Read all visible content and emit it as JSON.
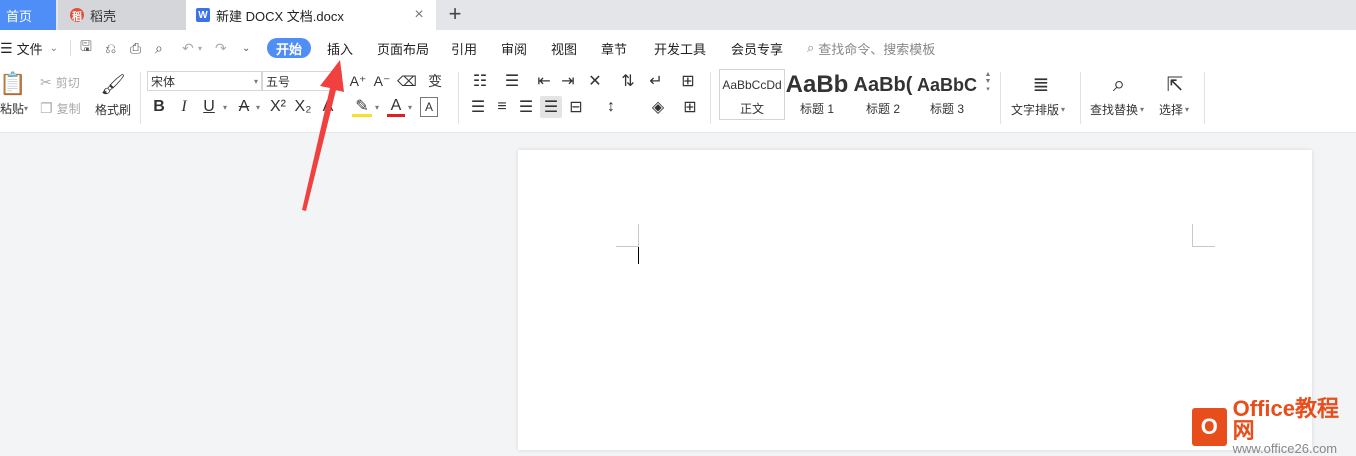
{
  "tabs": {
    "home": "首页",
    "daoke": "稻壳",
    "doc": "新建 DOCX 文档.docx",
    "close": "×",
    "add": "+"
  },
  "menu": {
    "file": "文件",
    "start": "开始",
    "items": [
      "插入",
      "页面布局",
      "引用",
      "审阅",
      "视图",
      "章节",
      "开发工具",
      "会员专享"
    ],
    "search": "查找命令、搜索模板"
  },
  "ribbon": {
    "paste": "粘贴",
    "cut": "剪切",
    "copy": "复制",
    "format_painter": "格式刷",
    "font_name": "宋体",
    "font_size": "五号",
    "styles": [
      {
        "preview": "AaBbCcDd",
        "label": "正文"
      },
      {
        "preview": "AaBb",
        "label": "标题 1"
      },
      {
        "preview": "AaBb(",
        "label": "标题 2"
      },
      {
        "preview": "AaBbC",
        "label": "标题 3"
      }
    ],
    "text_layout": "文字排版",
    "find_replace": "查找替换",
    "select": "选择"
  },
  "watermark": {
    "brand": "Office教程网",
    "url": "www.office26.com"
  },
  "colors": {
    "accent": "#4f8ef7",
    "arrow": "#f04040",
    "logo": "#e84e1b"
  }
}
